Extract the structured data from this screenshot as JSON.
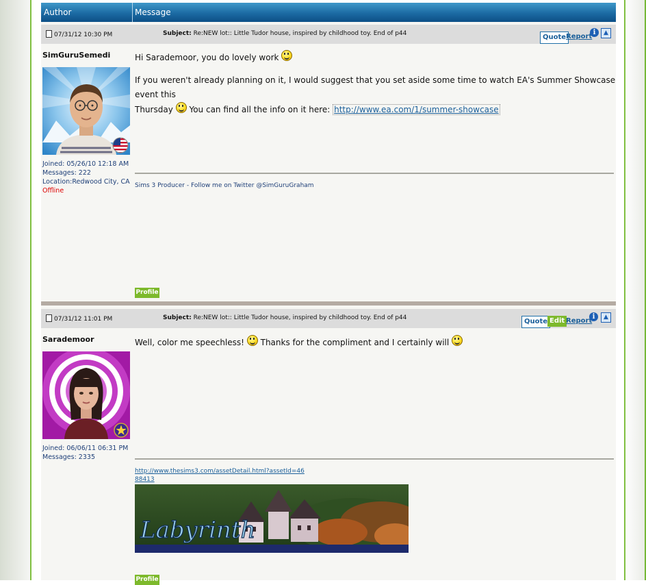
{
  "table": {
    "author_header": "Author",
    "message_header": "Message"
  },
  "posts": [
    {
      "date": "07/31/12 10:30 PM",
      "subject_label": "Subject:",
      "subject": "Re:NEW lot:: Little Tudor house, inspired by childhood toy. End of p44",
      "quote": "Quote",
      "report": "Report",
      "author": "SimGuruSemedi",
      "joined": "Joined: 05/26/10 12:18 AM",
      "messages": "Messages: 222",
      "location": "Location:Redwood City, CA",
      "status": "Offline",
      "line1": "Hi Sarademoor, you do lovely work",
      "line2": "If you weren't already planning on it, I would suggest that you set aside some time to watch EA's Summer Showcase event this",
      "line3a": "Thursday",
      "line3b": "You can find all the info on it here:",
      "link": "http://www.ea.com/1/summer-showcase",
      "signature": "Sims 3 Producer - Follow me on Twitter @SimGuruGraham",
      "profile": "Profile"
    },
    {
      "date": "07/31/12 11:01 PM",
      "subject_label": "Subject:",
      "subject": "Re:NEW lot:: Little Tudor house, inspired by childhood toy. End of p44",
      "quote": "Quote",
      "edit": "Edit",
      "report": "Report",
      "author": "Sarademoor",
      "joined": "Joined: 06/06/11 06:31 PM",
      "messages": "Messages: 2335",
      "msg_a": "Well, color me speechless!",
      "msg_b": "Thanks for the compliment and I certainly will",
      "sig_link_1": "http://www.thesims3.com/assetDetail.html?assetId=46",
      "sig_link_2": "88413",
      "banner_text": "Labyrinth",
      "profile": "Profile"
    }
  ],
  "icons": [
    "document-icon",
    "info-icon",
    "back-to-top-icon",
    "smiley-icon",
    "us-flag-icon",
    "star-badge-icon"
  ]
}
